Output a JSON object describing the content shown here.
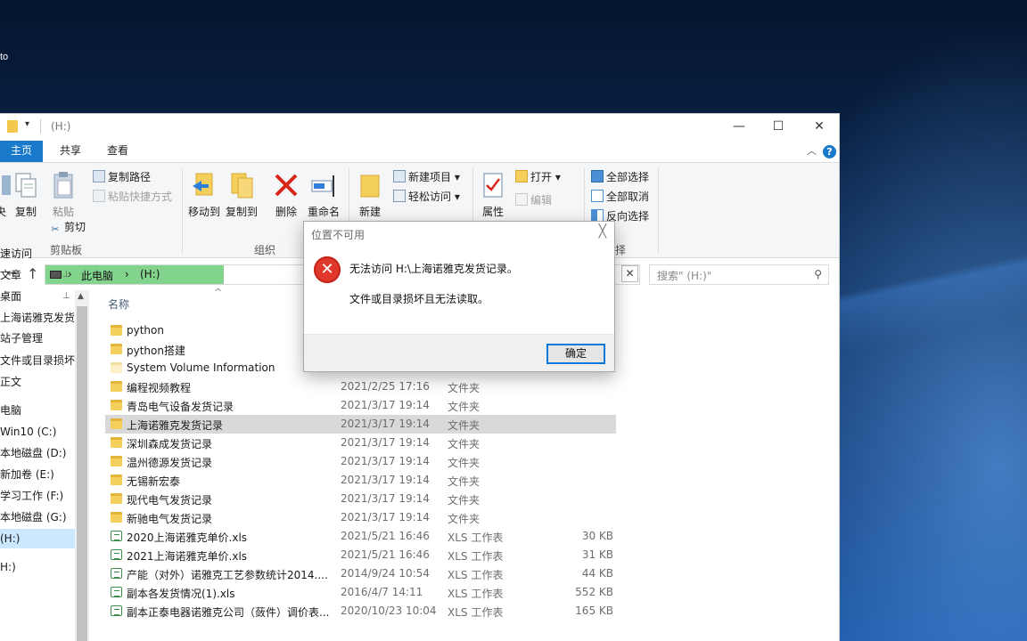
{
  "desktop": {
    "icon_label": "to"
  },
  "window": {
    "title": "(H:)",
    "qa_dropdown": "▾",
    "controls": {
      "minimize": "—",
      "maximize": "☐",
      "close": "✕"
    },
    "tabs": [
      "主页",
      "共享",
      "查看"
    ],
    "help": "?",
    "collapse": "︿"
  },
  "ribbon": {
    "clipboard": {
      "pin_partial": "夬",
      "copy": "复制",
      "paste": "粘贴",
      "copy_path": "复制路径",
      "paste_shortcut": "粘贴快捷方式",
      "cut": "剪切",
      "label": "剪贴板"
    },
    "organize": {
      "move_to": "移动到",
      "copy_to": "复制到",
      "delete": "删除",
      "rename": "重命名",
      "label": "组织"
    },
    "new": {
      "new_folder": "新建",
      "new_item": "新建项目",
      "easy_access": "轻松访问"
    },
    "open": {
      "properties": "属性",
      "open": "打开",
      "edit": "编辑"
    },
    "select": {
      "select_all": "全部选择",
      "select_none": "全部取消",
      "invert": "反向选择",
      "label": "择"
    }
  },
  "address": {
    "back": "←",
    "up": "↑",
    "sep1": "›",
    "this_pc": "此电脑",
    "sep2": "›",
    "drive": "(H:)",
    "clear": "✕",
    "search_placeholder": "搜索\" (H:)\"",
    "progress_fraction": 0.3
  },
  "nav": {
    "scroll_up": "▲",
    "items": [
      {
        "label": "速访问",
        "pinned": false
      },
      {
        "label": "文章",
        "pinned": true
      },
      {
        "label": "桌面",
        "pinned": true
      },
      {
        "label": "上海诺雅克发货",
        "pinned": false
      },
      {
        "label": "站子管理",
        "pinned": false
      },
      {
        "label": "文件或目录损坏",
        "pinned": false
      },
      {
        "label": "正文",
        "pinned": false
      },
      {
        "label": "电脑",
        "pinned": false
      },
      {
        "label": "Win10 (C:)",
        "pinned": false
      },
      {
        "label": "本地磁盘 (D:)",
        "pinned": false
      },
      {
        "label": "新加卷 (E:)",
        "pinned": false
      },
      {
        "label": "学习工作 (F:)",
        "pinned": false
      },
      {
        "label": "本地磁盘 (G:)",
        "pinned": false
      },
      {
        "label": "(H:)",
        "pinned": false
      },
      {
        "label": "H:)",
        "pinned": false
      }
    ],
    "pin_glyph": "📌"
  },
  "list": {
    "col_name": "名称",
    "sort_glyph": "^",
    "rows": [
      {
        "name": "python",
        "date": "",
        "type": "",
        "size": "",
        "kind": "folder"
      },
      {
        "name": "python搭建",
        "date": "",
        "type": "",
        "size": "",
        "kind": "folder"
      },
      {
        "name": "System Volume Information",
        "date": "",
        "type": "",
        "size": "",
        "kind": "folder-pale"
      },
      {
        "name": "编程视频教程",
        "date": "2021/2/25 17:16",
        "type": "文件夹",
        "size": "",
        "kind": "folder"
      },
      {
        "name": "青岛电气设备发货记录",
        "date": "2021/3/17 19:14",
        "type": "文件夹",
        "size": "",
        "kind": "folder"
      },
      {
        "name": "上海诺雅克发货记录",
        "date": "2021/3/17 19:14",
        "type": "文件夹",
        "size": "",
        "kind": "folder",
        "selected": true
      },
      {
        "name": "深圳森成发货记录",
        "date": "2021/3/17 19:14",
        "type": "文件夹",
        "size": "",
        "kind": "folder"
      },
      {
        "name": "温州德源发货记录",
        "date": "2021/3/17 19:14",
        "type": "文件夹",
        "size": "",
        "kind": "folder"
      },
      {
        "name": "无锡新宏泰",
        "date": "2021/3/17 19:14",
        "type": "文件夹",
        "size": "",
        "kind": "folder"
      },
      {
        "name": "现代电气发货记录",
        "date": "2021/3/17 19:14",
        "type": "文件夹",
        "size": "",
        "kind": "folder"
      },
      {
        "name": "新驰电气发货记录",
        "date": "2021/3/17 19:14",
        "type": "文件夹",
        "size": "",
        "kind": "folder"
      },
      {
        "name": "2020上海诺雅克单价.xls",
        "date": "2021/5/21 16:46",
        "type": "XLS 工作表",
        "size": "30 KB",
        "kind": "xls"
      },
      {
        "name": "2021上海诺雅克单价.xls",
        "date": "2021/5/21 16:46",
        "type": "XLS 工作表",
        "size": "31 KB",
        "kind": "xls"
      },
      {
        "name": "产能（对外）诺雅克工艺参数统计2014....",
        "date": "2014/9/24 10:54",
        "type": "XLS 工作表",
        "size": "44 KB",
        "kind": "xls"
      },
      {
        "name": "副本各发货情况(1).xls",
        "date": "2016/4/7 14:11",
        "type": "XLS 工作表",
        "size": "552 KB",
        "kind": "xls"
      },
      {
        "name": "副本正泰电器诺雅克公司（蔹件）调价表...",
        "date": "2020/10/23 10:04",
        "type": "XLS 工作表",
        "size": "165 KB",
        "kind": "xls"
      }
    ]
  },
  "dialog": {
    "title": "位置不可用",
    "close": "╳",
    "icon": "✕",
    "message1": "无法访问 H:\\上海诺雅克发货记录。",
    "message2": "文件或目录损坏且无法读取。",
    "ok": "确定"
  },
  "colors": {
    "accent": "#1979ca",
    "progress": "#82d38c",
    "error": "#e0382b"
  }
}
